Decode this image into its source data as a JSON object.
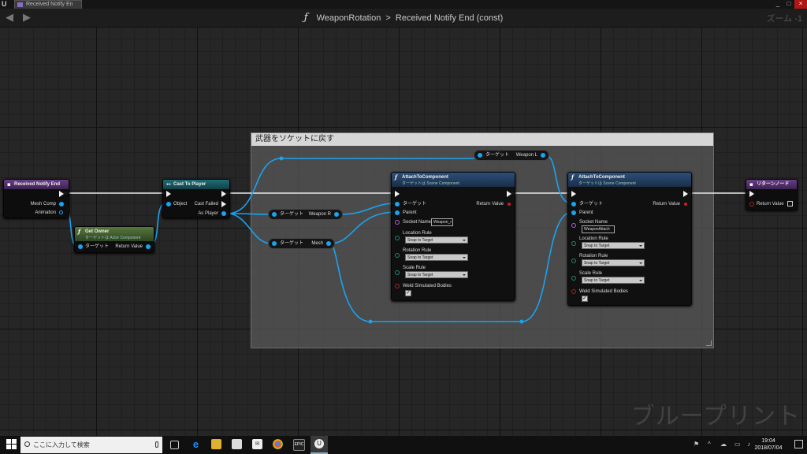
{
  "window": {
    "tab_label": "Received Notify En",
    "min": "_",
    "restore": "□",
    "close": "×"
  },
  "nav": {
    "back": "◀",
    "forward": "▶",
    "function_glyph": "ƒ",
    "function_name": "WeaponRotation",
    "separator": ">",
    "graph_name": "Received Notify End (const)",
    "zoom": "ズーム -1"
  },
  "comment": {
    "title": "武器をソケットに戻す"
  },
  "watermark": "ブループリント",
  "nodes": {
    "received_notify_end": {
      "title": "Received Notify End",
      "pins": {
        "mesh_comp": "Mesh Comp",
        "animation": "Animation"
      }
    },
    "get_owner": {
      "title": "Get Owner",
      "subtitle": "ターゲットは Actor Component",
      "target": "ターゲット",
      "return_value": "Return Value"
    },
    "cast_to_player": {
      "title": "Cast To Player",
      "object": "Object",
      "cast_failed": "Cast Failed",
      "as_player": "As Player"
    },
    "get_weapon_r": {
      "target": "ターゲット",
      "name": "Weapon R"
    },
    "get_weapon_l": {
      "target": "ターゲット",
      "name": "Weapon L"
    },
    "get_mesh": {
      "target": "ターゲット",
      "name": "Mesh"
    },
    "attach1": {
      "title": "AttachToComponent",
      "subtitle": "ターゲットは Scene Component",
      "target": "ターゲット",
      "parent": "Parent",
      "socket_name_label": "Socket Name",
      "socket_name_value": "Weapon_r",
      "location_rule": "Location Rule",
      "location_value": "Snap to Target",
      "rotation_rule": "Rotation Rule",
      "rotation_value": "Snap to Target",
      "scale_rule": "Scale Rule",
      "scale_value": "Snap to Target",
      "weld": "Weld Simulated Bodies",
      "return_value": "Return Value"
    },
    "attach2": {
      "title": "AttachToComponent",
      "subtitle": "ターゲットは Scene Component",
      "target": "ターゲット",
      "parent": "Parent",
      "socket_name_label": "Socket Name",
      "socket_name_value": "WeaponAttach",
      "location_rule": "Location Rule",
      "location_value": "Snap to Target",
      "rotation_rule": "Rotation Rule",
      "rotation_value": "Snap to Target",
      "scale_rule": "Scale Rule",
      "scale_value": "Snap to Target",
      "weld": "Weld Simulated Bodies",
      "return_value": "Return Value"
    },
    "return_node": {
      "title": "リターンノード",
      "return_value": "Return Value"
    }
  },
  "taskbar": {
    "search_placeholder": "ここに入力して検索",
    "epic_label": "EPIC",
    "time": "19:04",
    "date": "2018/07/04"
  },
  "colors": {
    "exec": "#f2f2f2",
    "object_pin": "#1aa3f0",
    "enum_pin": "#1e8a70",
    "bool_pin": "#b02020",
    "name_pin": "#b55cd6"
  }
}
